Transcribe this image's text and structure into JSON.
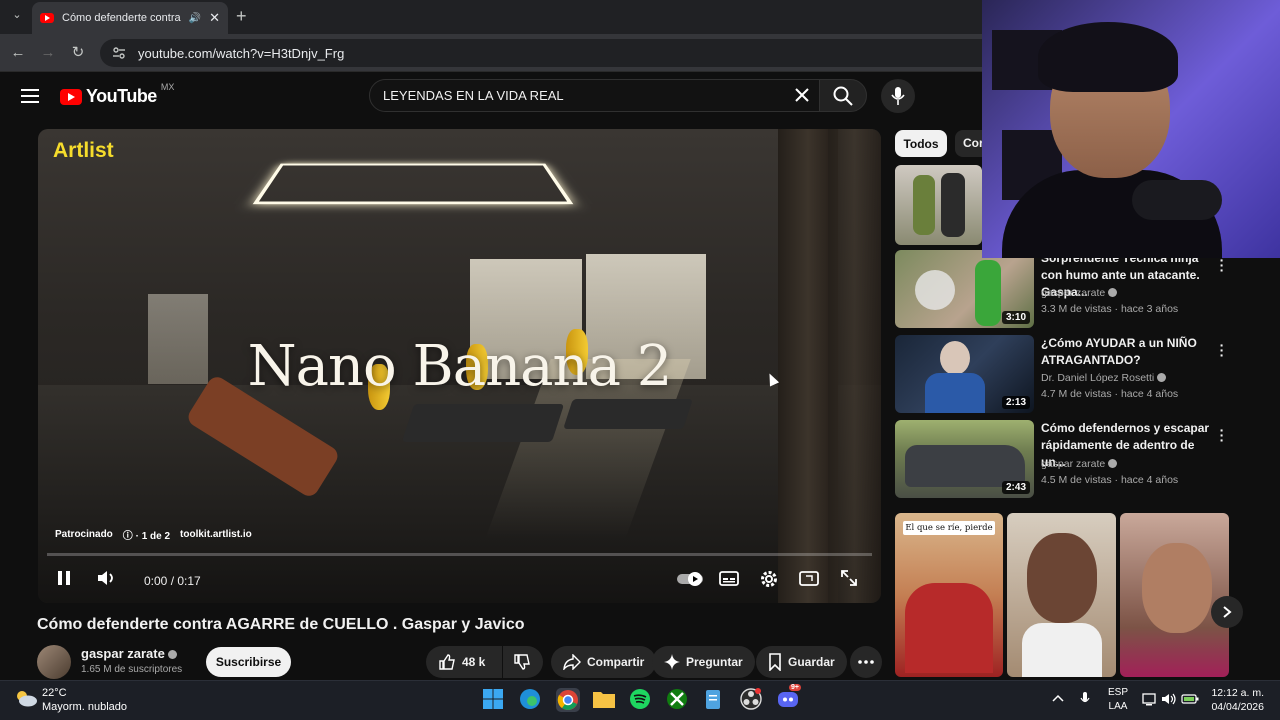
{
  "browser": {
    "tab_title": "Cómo defenderte contra A",
    "url": "youtube.com/watch?v=H3tDnjv_Frg"
  },
  "header": {
    "logo_text": "YouTube",
    "region": "MX",
    "search_value": "LEYENDAS EN LA VIDA REAL"
  },
  "player": {
    "brand": "Artlist",
    "overlay_title": "Nano Banana 2",
    "sponsored": "Patrocinado",
    "ad_count": "1 de 2",
    "ad_url": "toolkit.artlist.io",
    "time": "0:00 / 0:17",
    "progress": 0
  },
  "video": {
    "title": "Cómo defenderte contra AGARRE de CUELLO . Gaspar y Javico",
    "channel": "gaspar zarate",
    "subscribers": "1.65 M de suscriptores",
    "subscribe_label": "Suscribirse",
    "likes": "48 k",
    "share_label": "Compartir",
    "ask_label": "Preguntar",
    "save_label": "Guardar"
  },
  "sidebar": {
    "chips": [
      "Todos",
      "Cor"
    ],
    "recs": [
      {
        "title": "Sorprendente Técnica ninja con humo ante un atacante. Gaspa...",
        "channel": "gaspar zarate",
        "meta": "3.3 M de vistas · hace 3 años",
        "duration": "3:10"
      },
      {
        "title": "¿Cómo AYUDAR a un NIÑO ATRAGANTADO?",
        "channel": "Dr. Daniel López Rosetti",
        "meta": "4.7 M de vistas · hace 4 años",
        "duration": "2:13"
      },
      {
        "title": "Cómo defendernos y escapar rápidamente de adentro de un...",
        "channel": "gaspar zarate",
        "meta": "4.5 M de vistas · hace 4 años",
        "duration": "2:43"
      }
    ],
    "shorts_caption": "El que se ríe, pierde"
  },
  "taskbar": {
    "temperature": "22°C",
    "weather": "Mayorm. nublado",
    "lang1": "ESP",
    "lang2": "LAA",
    "time": "12:12 a. m.",
    "date": "04/04/2026",
    "discord_badge": "9+"
  },
  "colors": {
    "background": "#0f0f0f",
    "youtube_red": "#ff0000",
    "artlist_yellow": "#f6dc2c",
    "taskbar": "#1c1f26"
  }
}
